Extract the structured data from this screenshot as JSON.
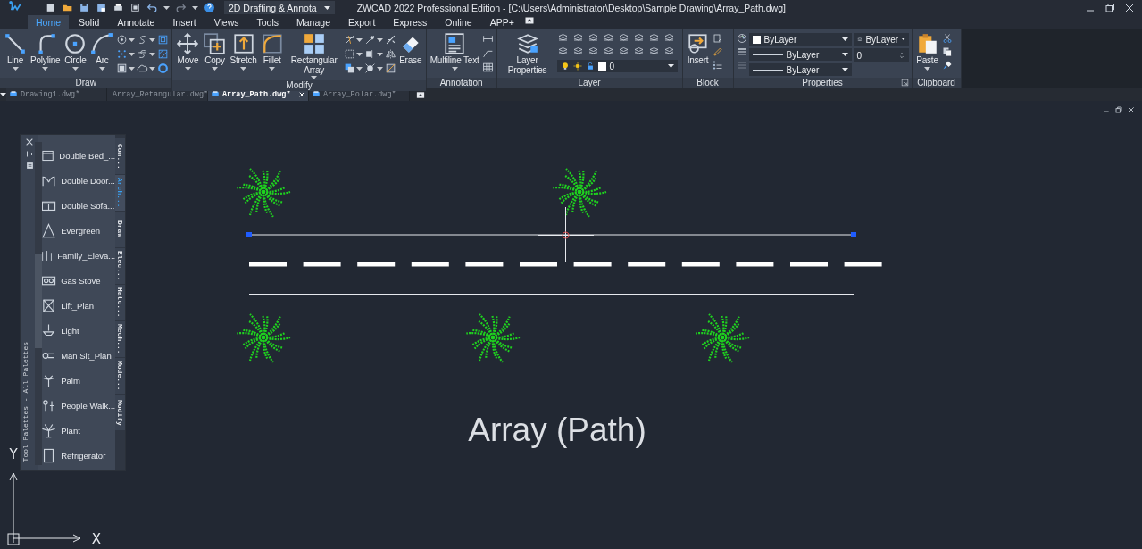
{
  "title_bar": {
    "workspace": "2D Drafting & Annota",
    "title": "ZWCAD 2022 Professional Edition - [C:\\Users\\Administrator\\Desktop\\Sample Drawing\\Array_Path.dwg]"
  },
  "menu_tabs": [
    {
      "label": "Home",
      "selected": true
    },
    {
      "label": "Solid",
      "selected": false
    },
    {
      "label": "Annotate",
      "selected": false
    },
    {
      "label": "Insert",
      "selected": false
    },
    {
      "label": "Views",
      "selected": false
    },
    {
      "label": "Tools",
      "selected": false
    },
    {
      "label": "Manage",
      "selected": false
    },
    {
      "label": "Export",
      "selected": false
    },
    {
      "label": "Express",
      "selected": false
    },
    {
      "label": "Online",
      "selected": false
    },
    {
      "label": "APP+",
      "selected": false
    }
  ],
  "ribbon": {
    "draw": {
      "title": "Draw",
      "tools": [
        "Line",
        "Polyline",
        "Circle",
        "Arc"
      ]
    },
    "modify": {
      "title": "Modify",
      "tools": [
        "Move",
        "Copy",
        "Stretch",
        "Fillet",
        "Rectangular Array"
      ],
      "erase": "Erase"
    },
    "annotation": {
      "title": "Annotation",
      "tool": "Multiline Text"
    },
    "layer": {
      "title": "Layer",
      "tool": "Layer Properties",
      "current_layer": "0"
    },
    "block": {
      "title": "Block",
      "tool": "Insert"
    },
    "properties": {
      "title": "Properties",
      "color_setting": "ByLayer",
      "linetype": "ByLayer",
      "lineweight": "ByLayer",
      "layer_style": "ByLayer",
      "transparency": "0"
    },
    "clipboard": {
      "title": "Clipboard",
      "tool": "Paste"
    }
  },
  "document_tabs": [
    {
      "label": "Drawing1.dwg*",
      "selected": false
    },
    {
      "label": "Array_Retangular.dwg*",
      "selected": false
    },
    {
      "label": "Array_Path.dwg*",
      "selected": true
    },
    {
      "label": "Array_Polar.dwg*",
      "selected": false
    }
  ],
  "tool_palette": {
    "title": "Tool Palettes - All Palettes",
    "items": [
      "Double Bed_...",
      "Double Door...",
      "Double Sofa...",
      "Evergreen",
      "Family_Eleva...",
      "Gas Stove",
      "Lift_Plan",
      "Light",
      "Man Sit_Plan",
      "Palm",
      "People Walk...",
      "Plant",
      "Refrigerator"
    ],
    "tabs": [
      {
        "label": "Com...",
        "selected": false
      },
      {
        "label": "Arch...",
        "selected": true
      },
      {
        "label": "Draw",
        "selected": false
      },
      {
        "label": "Elec...",
        "selected": false
      },
      {
        "label": "Hatc...",
        "selected": false
      },
      {
        "label": "Mech...",
        "selected": false
      },
      {
        "label": "Mode...",
        "selected": false
      },
      {
        "label": "Modify",
        "selected": false
      }
    ]
  },
  "drawing": {
    "caption": "Array (Path)",
    "ucs": {
      "x_label": "X",
      "y_label": "Y"
    }
  }
}
